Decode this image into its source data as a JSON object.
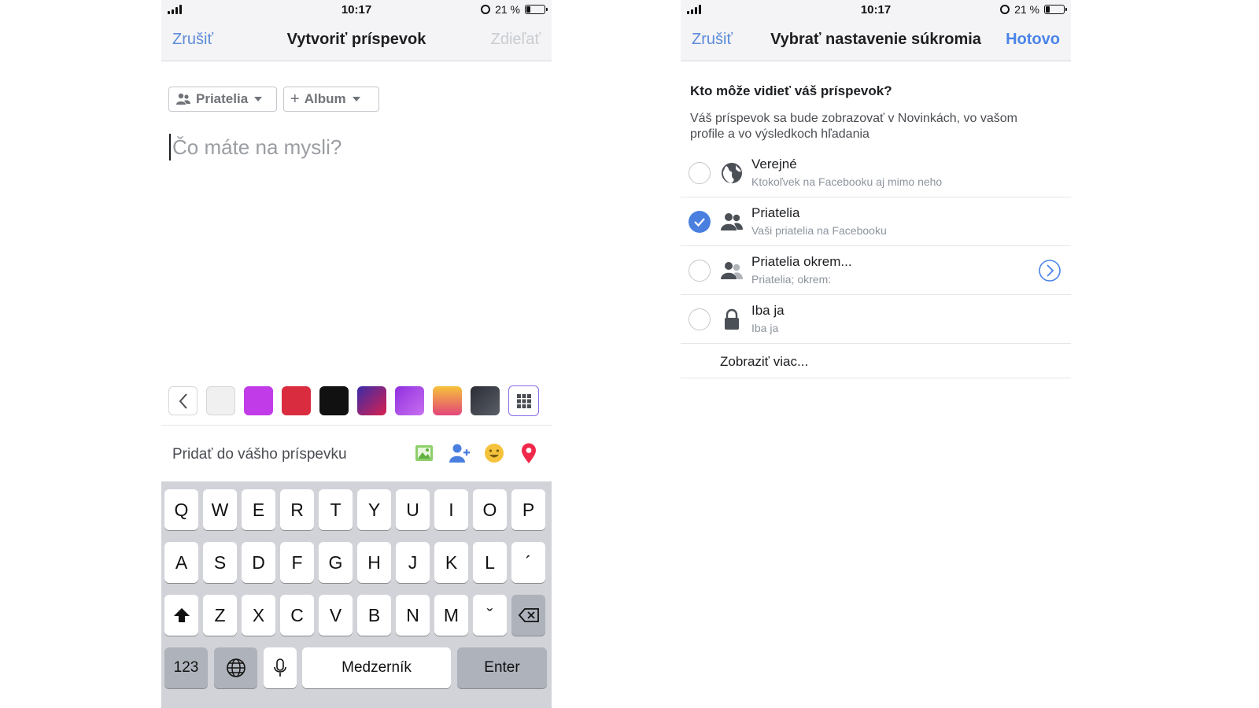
{
  "status": {
    "time": "10:17",
    "battery": "21 %",
    "battery_level": 0.21
  },
  "left_screen": {
    "nav": {
      "cancel": "Zrušiť",
      "title": "Vytvoriť príspevok",
      "share": "Zdieľať"
    },
    "audience_chip": "Priatelia",
    "album_chip": "Album",
    "composer_placeholder": "Čo máte na mysli?",
    "backgrounds": [
      "#f0f0f0",
      "#c13ce8",
      "#d92d3f",
      "#111111",
      "gradient-purple-red",
      "gradient-violet",
      "gradient-orange",
      "gradient-dark"
    ],
    "add_to_post": "Pridať do vášho príspevku",
    "add_icons": [
      "photo-icon",
      "tag-people-icon",
      "feeling-icon",
      "location-icon"
    ]
  },
  "keyboard": {
    "row1": [
      "Q",
      "W",
      "E",
      "R",
      "T",
      "Y",
      "U",
      "I",
      "O",
      "P"
    ],
    "row2": [
      "A",
      "S",
      "D",
      "F",
      "G",
      "H",
      "J",
      "K",
      "L",
      "´"
    ],
    "row3": [
      "Z",
      "X",
      "C",
      "V",
      "B",
      "N",
      "M",
      "ˇ"
    ],
    "numbers": "123",
    "space": "Medzerník",
    "enter": "Enter"
  },
  "right_screen": {
    "nav": {
      "cancel": "Zrušiť",
      "title": "Vybrať nastavenie súkromia",
      "done": "Hotovo"
    },
    "question": "Kto môže vidieť váš príspevok?",
    "description": "Váš príspevok sa bude zobrazovať v Novinkách, vo vašom profile a vo výsledkoch hľadania",
    "options": [
      {
        "title": "Verejné",
        "subtitle": "Ktokoľvek na Facebooku aj mimo neho",
        "icon": "globe-icon",
        "selected": false
      },
      {
        "title": "Priatelia",
        "subtitle": "Vaši priatelia na Facebooku",
        "icon": "friends-icon",
        "selected": true
      },
      {
        "title": "Priatelia okrem...",
        "subtitle": "Priatelia; okrem:",
        "icon": "friends-except-icon",
        "selected": false
      },
      {
        "title": "Iba ja",
        "subtitle": "Iba ja",
        "icon": "lock-icon",
        "selected": false
      }
    ],
    "show_more": "Zobraziť viac..."
  },
  "colors": {
    "accent": "#4a84e8",
    "disabled": "#c9ccd1",
    "keyboard_bg": "#d1d3d9"
  }
}
